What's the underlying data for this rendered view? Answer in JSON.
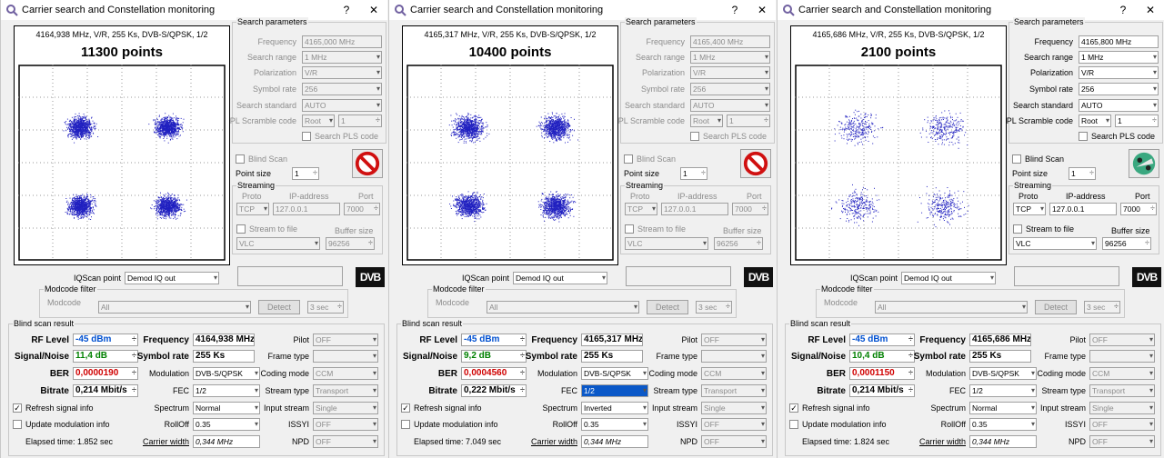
{
  "panels": [
    {
      "title": "Carrier search and Constellation monitoring",
      "scope_info": "4164,938 MHz, V/R, 255 Ks, DVB-S/QPSK, 1/2",
      "points": "11300 points",
      "enabled": false,
      "params_title": "Search parameters",
      "frequency_label": "Frequency",
      "frequency": "4165,000 MHz",
      "search_range_label": "Search range",
      "search_range": "1 MHz",
      "polarization_label": "Polarization",
      "polarization": "V/R",
      "symbol_rate_label": "Symbol rate",
      "symbol_rate": "256",
      "search_standard_label": "Search standard",
      "search_standard": "AUTO",
      "pl_scramble_label": "PL Scramble code",
      "pl_scramble": "Root",
      "pl_scramble_num": "1",
      "search_pls_label": "Search PLS code",
      "blind_scan_label": "Blind Scan",
      "point_size_label": "Point size",
      "point_size": "1",
      "streaming_title": "Streaming",
      "proto_label": "Proto",
      "proto": "TCP",
      "ip_label": "IP-address",
      "ip": "127.0.0.1",
      "port_label": "Port",
      "port": "7000",
      "stream_to_file_label": "Stream to file",
      "buffer_size_label": "Buffer size",
      "player": "VLC",
      "buffer_size": "96256",
      "iq_label": "IQScan point",
      "iq_value": "Demod IQ out",
      "dvb_logo": "DVB",
      "modcode_filter_title": "Modcode filter",
      "modcode_label": "Modcode",
      "modcode": "All",
      "detect_label": "Detect",
      "detect_time": "3 sec",
      "blind_result_title": "Blind scan result",
      "rf_level_label": "RF Level",
      "rf_level": "-45 dBm",
      "snr_label": "Signal/Noise",
      "snr": "11,4 dB",
      "ber_label": "BER",
      "ber": "0,0000190",
      "bitrate_label": "Bitrate",
      "bitrate": "0,214 Mbit/s",
      "res_frequency_label": "Frequency",
      "res_frequency": "4164,938 MHz",
      "res_symbol_rate_label": "Symbol rate",
      "res_symbol_rate": "255 Ks",
      "modulation_label": "Modulation",
      "modulation": "DVB-S/QPSK",
      "fec_label": "FEC",
      "fec": "1/2",
      "spectrum_label": "Spectrum",
      "spectrum": "Normal",
      "rolloff_label": "RollOff",
      "rolloff": "0.35",
      "carrier_width_label": "Carrier width",
      "carrier_width": "0,344 MHz",
      "pilot_label": "Pilot",
      "pilot": "OFF",
      "frame_type_label": "Frame type",
      "frame_type": "",
      "coding_mode_label": "Coding mode",
      "coding_mode": "CCM",
      "stream_type_label": "Stream type",
      "stream_type": "Transport",
      "input_stream_label": "Input stream",
      "input_stream": "Single",
      "issyi_label": "ISSYI",
      "issyi": "OFF",
      "npd_label": "NPD",
      "npd": "OFF",
      "refresh_label": "Refresh signal info",
      "update_mod_label": "Update modulation info",
      "elapsed": "Elapsed time: 1.852 sec"
    },
    {
      "title": "Carrier search and Constellation monitoring",
      "scope_info": "4165,317 MHz, V/R, 255 Ks, DVB-S/QPSK, 1/2",
      "points": "10400 points",
      "enabled": false,
      "params_title": "Search parameters",
      "frequency_label": "Frequency",
      "frequency": "4165,400 MHz",
      "search_range_label": "Search range",
      "search_range": "1 MHz",
      "polarization_label": "Polarization",
      "polarization": "V/R",
      "symbol_rate_label": "Symbol rate",
      "symbol_rate": "256",
      "search_standard_label": "Search standard",
      "search_standard": "AUTO",
      "pl_scramble_label": "PL Scramble code",
      "pl_scramble": "Root",
      "pl_scramble_num": "1",
      "search_pls_label": "Search PLS code",
      "blind_scan_label": "Blind Scan",
      "point_size_label": "Point size",
      "point_size": "1",
      "streaming_title": "Streaming",
      "proto_label": "Proto",
      "proto": "TCP",
      "ip_label": "IP-address",
      "ip": "127.0.0.1",
      "port_label": "Port",
      "port": "7000",
      "stream_to_file_label": "Stream to file",
      "buffer_size_label": "Buffer size",
      "player": "VLC",
      "buffer_size": "96256",
      "iq_label": "IQScan point",
      "iq_value": "Demod IQ out",
      "dvb_logo": "DVB",
      "modcode_filter_title": "Modcode filter",
      "modcode_label": "Modcode",
      "modcode": "All",
      "detect_label": "Detect",
      "detect_time": "3 sec",
      "blind_result_title": "Blind scan result",
      "rf_level_label": "RF Level",
      "rf_level": "-45 dBm",
      "snr_label": "Signal/Noise",
      "snr": "9,2 dB",
      "ber_label": "BER",
      "ber": "0,0004560",
      "bitrate_label": "Bitrate",
      "bitrate": "0,222 Mbit/s",
      "res_frequency_label": "Frequency",
      "res_frequency": "4165,317 MHz",
      "res_symbol_rate_label": "Symbol rate",
      "res_symbol_rate": "255 Ks",
      "modulation_label": "Modulation",
      "modulation": "DVB-S/QPSK",
      "fec_label": "FEC",
      "fec": "1/2",
      "spectrum_label": "Spectrum",
      "spectrum": "Inverted",
      "rolloff_label": "RollOff",
      "rolloff": "0.35",
      "carrier_width_label": "Carrier width",
      "carrier_width": "0,344 MHz",
      "pilot_label": "Pilot",
      "pilot": "OFF",
      "frame_type_label": "Frame type",
      "frame_type": "",
      "coding_mode_label": "Coding mode",
      "coding_mode": "CCM",
      "stream_type_label": "Stream type",
      "stream_type": "Transport",
      "input_stream_label": "Input stream",
      "input_stream": "Single",
      "issyi_label": "ISSYI",
      "issyi": "OFF",
      "npd_label": "NPD",
      "npd": "OFF",
      "refresh_label": "Refresh signal info",
      "update_mod_label": "Update modulation info",
      "elapsed": "Elapsed time: 7.049 sec"
    },
    {
      "title": "Carrier search and Constellation monitoring",
      "scope_info": "4165,686 MHz, V/R, 255 Ks, DVB-S/QPSK, 1/2",
      "points": "2100 points",
      "enabled": true,
      "params_title": "Search parameters",
      "frequency_label": "Frequency",
      "frequency": "4165,800 MHz",
      "search_range_label": "Search range",
      "search_range": "1 MHz",
      "polarization_label": "Polarization",
      "polarization": "V/R",
      "symbol_rate_label": "Symbol rate",
      "symbol_rate": "256",
      "search_standard_label": "Search standard",
      "search_standard": "AUTO",
      "pl_scramble_label": "PL Scramble code",
      "pl_scramble": "Root",
      "pl_scramble_num": "1",
      "search_pls_label": "Search PLS code",
      "blind_scan_label": "Blind Scan",
      "point_size_label": "Point size",
      "point_size": "1",
      "streaming_title": "Streaming",
      "proto_label": "Proto",
      "proto": "TCP",
      "ip_label": "IP-address",
      "ip": "127.0.0.1",
      "port_label": "Port",
      "port": "7000",
      "stream_to_file_label": "Stream to file",
      "buffer_size_label": "Buffer size",
      "player": "VLC",
      "buffer_size": "96256",
      "iq_label": "IQScan point",
      "iq_value": "Demod IQ out",
      "dvb_logo": "DVB",
      "modcode_filter_title": "Modcode filter",
      "modcode_label": "Modcode",
      "modcode": "All",
      "detect_label": "Detect",
      "detect_time": "3 sec",
      "blind_result_title": "Blind scan result",
      "rf_level_label": "RF Level",
      "rf_level": "-45 dBm",
      "snr_label": "Signal/Noise",
      "snr": "10,4 dB",
      "ber_label": "BER",
      "ber": "0,0001150",
      "bitrate_label": "Bitrate",
      "bitrate": "0,214 Mbit/s",
      "res_frequency_label": "Frequency",
      "res_frequency": "4165,686 MHz",
      "res_symbol_rate_label": "Symbol rate",
      "res_symbol_rate": "255 Ks",
      "modulation_label": "Modulation",
      "modulation": "DVB-S/QPSK",
      "fec_label": "FEC",
      "fec": "1/2",
      "spectrum_label": "Spectrum",
      "spectrum": "Normal",
      "rolloff_label": "RollOff",
      "rolloff": "0.35",
      "carrier_width_label": "Carrier width",
      "carrier_width": "0,344 MHz",
      "pilot_label": "Pilot",
      "pilot": "OFF",
      "frame_type_label": "Frame type",
      "frame_type": "",
      "coding_mode_label": "Coding mode",
      "coding_mode": "CCM",
      "stream_type_label": "Stream type",
      "stream_type": "Transport",
      "input_stream_label": "Input stream",
      "input_stream": "Single",
      "issyi_label": "ISSYI",
      "issyi": "OFF",
      "npd_label": "NPD",
      "npd": "OFF",
      "refresh_label": "Refresh signal info",
      "update_mod_label": "Update modulation info",
      "elapsed": "Elapsed time: 1.824 sec"
    }
  ],
  "window_controls": {
    "help": "?",
    "close": "✕"
  },
  "colors": {
    "scatter": "#2020c0",
    "rf_level": "#0050d0",
    "snr": "#008000",
    "ber": "#d00000"
  }
}
